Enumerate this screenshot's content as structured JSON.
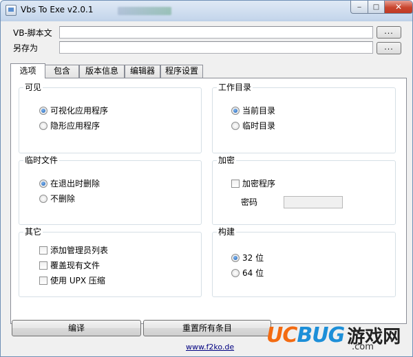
{
  "window": {
    "title": "Vbs To Exe v2.0.1",
    "controls": {
      "minimize": "‒",
      "maximize": "□",
      "close": "✕"
    }
  },
  "files": {
    "script_label": "VB-脚本文",
    "script_value": "",
    "saveas_label": "另存为",
    "saveas_value": "",
    "browse_label": "..."
  },
  "tabs": [
    {
      "label": "选项",
      "active": true
    },
    {
      "label": "包含",
      "active": false
    },
    {
      "label": "版本信息",
      "active": false
    },
    {
      "label": "编辑器",
      "active": false
    },
    {
      "label": "程序设置",
      "active": false
    }
  ],
  "groups": {
    "visible": {
      "title": "可见",
      "options": [
        {
          "label": "可视化应用程序",
          "checked": true
        },
        {
          "label": "隐形应用程序",
          "checked": false
        }
      ]
    },
    "workdir": {
      "title": "工作目录",
      "options": [
        {
          "label": "当前目录",
          "checked": true
        },
        {
          "label": "临时目录",
          "checked": false
        }
      ]
    },
    "tempfiles": {
      "title": "临时文件",
      "options": [
        {
          "label": "在退出时删除",
          "checked": true
        },
        {
          "label": "不删除",
          "checked": false
        }
      ]
    },
    "encrypt": {
      "title": "加密",
      "encrypt_label": "加密程序",
      "encrypt_checked": false,
      "password_label": "密码",
      "password_value": ""
    },
    "other": {
      "title": "其它",
      "options": [
        {
          "label": "添加管理员列表",
          "checked": false
        },
        {
          "label": "覆盖现有文件",
          "checked": false
        },
        {
          "label": "使用 UPX 压缩",
          "checked": false
        }
      ]
    },
    "build": {
      "title": "构建",
      "options": [
        {
          "label": "32 位",
          "checked": true
        },
        {
          "label": "64 位",
          "checked": false
        }
      ]
    }
  },
  "buttons": {
    "compile": "编译",
    "reset": "重置所有条目"
  },
  "footer": {
    "link": "www.f2ko.de"
  },
  "watermark": {
    "uc": "UC",
    "bug": "BUG",
    "cn": "游戏网",
    "domain": ".com"
  }
}
